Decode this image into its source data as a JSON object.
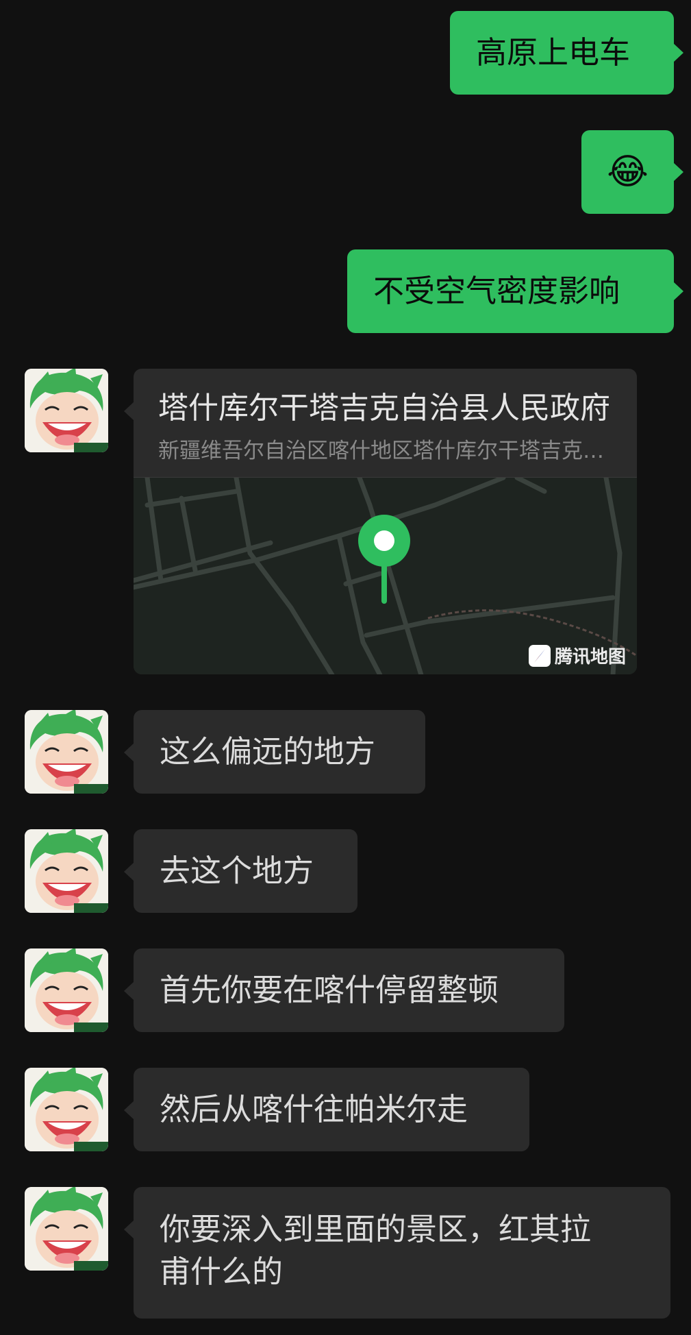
{
  "outgoing": [
    {
      "text": "高原上电车"
    },
    {
      "text": "😂"
    },
    {
      "text": "不受空气密度影响"
    }
  ],
  "location": {
    "title": "塔什库尔干塔吉克自治县人民政府",
    "address": "新疆维吾尔自治区喀什地区塔什库尔干塔吉克自治县",
    "map_brand": "腾讯地图",
    "pin_color": "#2fbe5f"
  },
  "incoming": [
    {
      "text": "这么偏远的地方"
    },
    {
      "text": "去这个地方"
    },
    {
      "text": "首先你要在喀什停留整顿"
    },
    {
      "text": "然后从喀什往帕米尔走"
    },
    {
      "line1": "你要深入到里面的景区，红其拉",
      "line2": "甫什么的"
    }
  ],
  "colors": {
    "background": "#111111",
    "outgoing_bubble": "#2fbe5f",
    "incoming_bubble": "#2b2b2b",
    "avatar_hair": "#3fae55"
  }
}
